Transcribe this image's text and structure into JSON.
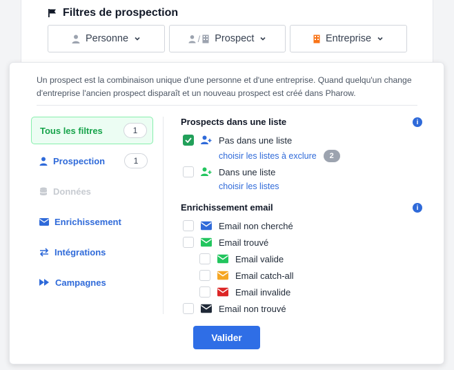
{
  "header": {
    "title": "Filtres de prospection"
  },
  "tabs": [
    {
      "label": "Personne",
      "icon": "person-icon",
      "color": "#9ca3af"
    },
    {
      "label": "Prospect",
      "prefix": "/",
      "icon": "person-building-icon",
      "color": "#9ca3af"
    },
    {
      "label": "Entreprise",
      "icon": "building-icon",
      "color": "#f97316"
    }
  ],
  "panel": {
    "description": "Un prospect est la combinaison unique d'une personne et d'une entreprise. Quand quelqu'un change d'entreprise l'ancien prospect disparaît et un nouveau prospect est créé dans Pharow."
  },
  "sidebar": {
    "items": [
      {
        "label": "Tous les filtres",
        "count": "1",
        "icon": ""
      },
      {
        "label": "Prospection",
        "count": "1",
        "icon": "person-icon"
      },
      {
        "label": "Données",
        "icon": "database-icon"
      },
      {
        "label": "Enrichissement",
        "icon": "envelope-icon"
      },
      {
        "label": "Intégrations",
        "icon": "swap-arrows-icon"
      },
      {
        "label": "Campagnes",
        "icon": "fast-forward-icon"
      }
    ]
  },
  "sections": {
    "lists": {
      "title": "Prospects dans une liste",
      "options": [
        {
          "label": "Pas dans une liste",
          "checked": true,
          "link": "choisir les listes à exclure",
          "badge": "2"
        },
        {
          "label": "Dans une liste",
          "checked": false,
          "link": "choisir les listes"
        }
      ]
    },
    "email": {
      "title": "Enrichissement email",
      "options": [
        {
          "label": "Email non cherché",
          "icon_color": "#2f6ad9"
        },
        {
          "label": "Email trouvé",
          "icon_color": "#22c55e"
        },
        {
          "label": "Email valide",
          "icon_color": "#22c55e"
        },
        {
          "label": "Email catch-all",
          "icon_color": "#f5a623"
        },
        {
          "label": "Email invalide",
          "icon_color": "#dc2626"
        },
        {
          "label": "Email non trouvé",
          "icon_color": "#1f2937"
        }
      ]
    }
  },
  "actions": {
    "validate_label": "Valider"
  }
}
